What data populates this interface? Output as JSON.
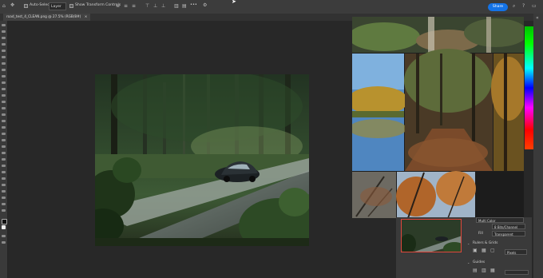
{
  "options_bar": {
    "auto_select_label": "Auto-Select",
    "layer_select": "Layer",
    "show_transform_label": "Show Transform Controls",
    "share_label": "Share",
    "more_label": "•••"
  },
  "document_tab": {
    "title": "road_test_4_CLEAN.png @ 27.5% (RGB/8#)",
    "close": "×"
  },
  "properties": {
    "mode_value": "Multi Color",
    "depth_value": "8 Bits/Channel",
    "fill_label": "Fill",
    "fill_value": "Transparent",
    "rulers_grids_label": "Rulers & Grids",
    "units_value": "Pixels",
    "guides_label": "Guides"
  },
  "colors": {
    "accent": "#1473e6",
    "selection_border": "#e0463c",
    "workspace": "#282828",
    "panel": "#3a3a3a"
  }
}
